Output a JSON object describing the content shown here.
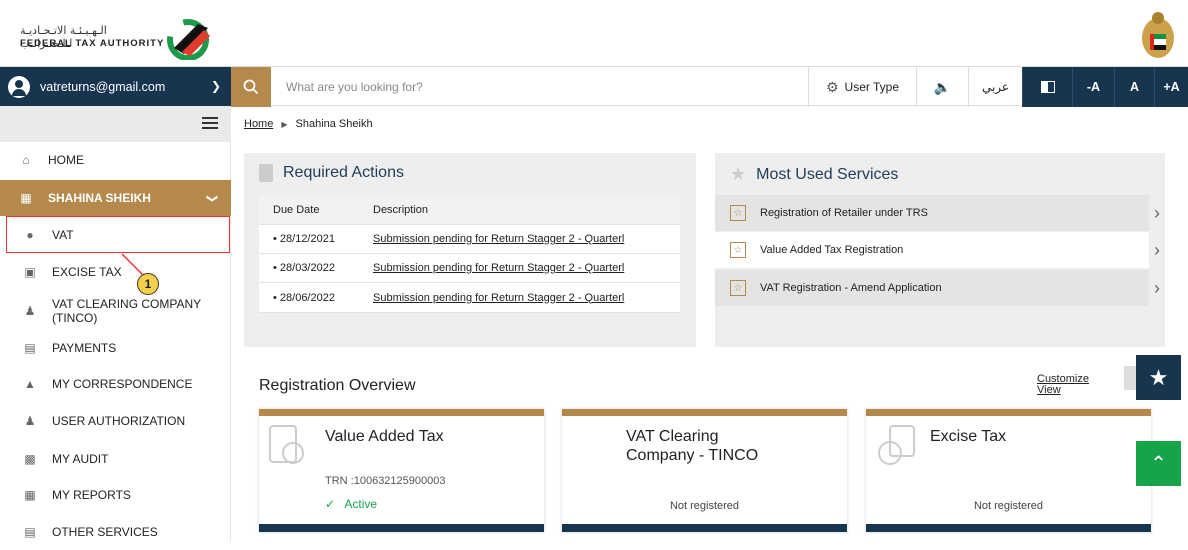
{
  "header": {
    "logo_arabic": "الـهـيـئـة الاتـحـاديـة لـلـضـرائـب",
    "logo_english": "FEDERAL TAX AUTHORITY"
  },
  "toolbar": {
    "account_email": "vatreturns@gmail.com",
    "search_placeholder": "What are you looking for?",
    "user_type_label": "User Type",
    "arabic_label": "عربي",
    "font_decrease": "-A",
    "font_normal": "A",
    "font_increase": "+A"
  },
  "sidebar": {
    "home": "HOME",
    "group": "SHAHINA SHEIKH",
    "items": [
      {
        "label": "VAT",
        "icon": "money-bag-icon"
      },
      {
        "label": "EXCISE TAX",
        "icon": "excise-icon"
      },
      {
        "label": "VAT CLEARING COMPANY (TINCO)",
        "label_line1": "VAT CLEARING COMPANY",
        "label_line2": "(TINCO)",
        "icon": "users-icon"
      },
      {
        "label": "PAYMENTS",
        "icon": "payment-icon"
      },
      {
        "label": "MY CORRESPONDENCE",
        "icon": "bank-icon"
      },
      {
        "label": "USER AUTHORIZATION",
        "icon": "users-icon"
      },
      {
        "label": "MY AUDIT",
        "icon": "audit-icon"
      },
      {
        "label": "MY REPORTS",
        "icon": "reports-icon"
      },
      {
        "label": "OTHER SERVICES",
        "icon": "services-icon"
      }
    ],
    "callout_number": "1"
  },
  "breadcrumb": {
    "home": "Home",
    "current": "Shahina Sheikh"
  },
  "required_actions": {
    "title": "Required Actions",
    "col_due": "Due Date",
    "col_desc": "Description",
    "rows": [
      {
        "date": "• 28/12/2021",
        "desc": "Submission pending for Return Stagger 2 - Quarterl"
      },
      {
        "date": "• 28/03/2022",
        "desc": "Submission pending for Return Stagger 2 - Quarterl"
      },
      {
        "date": "• 28/06/2022",
        "desc": "Submission pending for Return Stagger 2 - Quarterl"
      }
    ]
  },
  "most_used": {
    "title": "Most Used Services",
    "items": [
      "Registration of Retailer under TRS",
      "Value Added Tax Registration",
      "VAT Registration - Amend Application"
    ]
  },
  "registration": {
    "title": "Registration Overview",
    "customize_line1": "Customize",
    "customize_line2": "View",
    "cards": [
      {
        "title": "Value Added Tax",
        "trn": "TRN :100632125900003",
        "status": "Active"
      },
      {
        "title_line1": "VAT Clearing",
        "title_line2": "Company - TINCO",
        "status": "Not registered"
      },
      {
        "title": "Excise Tax",
        "status": "Not registered"
      }
    ]
  },
  "colors": {
    "navy": "#18354f",
    "gold": "#b5894c",
    "green": "#16a34a"
  }
}
